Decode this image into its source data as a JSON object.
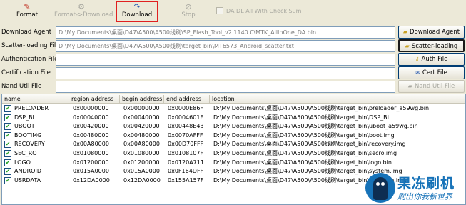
{
  "toolbar": {
    "format": {
      "label": "Format",
      "icon": "format-icon"
    },
    "format_download": {
      "label": "Format->Download",
      "icon": "format-download-icon"
    },
    "download": {
      "label": "Download",
      "icon": "download-icon"
    },
    "stop": {
      "label": "Stop",
      "icon": "stop-icon"
    },
    "checksum_label": "DA DL All With Check Sum"
  },
  "files": [
    {
      "label": "Download Agent",
      "value": "D:\\My Documents\\桌面\\D47\\A500\\A500线刷\\SP_Flash_Tool_v2.1140.0\\MTK_AllInOne_DA.bin",
      "button": "Download Agent",
      "icon": "folder-icon"
    },
    {
      "label": "Scatter-loading File",
      "value": "D:\\My Documents\\桌面\\D47\\A500\\A500线刷\\target_bin\\MT6573_Android_scatter.txt",
      "button": "Scatter-loading",
      "icon": "folder-icon"
    },
    {
      "label": "Authentication File",
      "value": "",
      "button": "Auth File",
      "icon": "key-icon"
    },
    {
      "label": "Certification File",
      "value": "",
      "button": "Cert File",
      "icon": "certificate-icon"
    },
    {
      "label": "Nand Util File",
      "value": "",
      "button": "Nand Util File",
      "icon": "folder-icon"
    }
  ],
  "table": {
    "headers": [
      "name",
      "region address",
      "begin address",
      "end address",
      "location"
    ],
    "rows": [
      {
        "checked": true,
        "name": "PRELOADER",
        "region": "0x00000000",
        "begin": "0x00000000",
        "end": "0x0000E86F",
        "location": "D:\\My Documents\\桌面\\D47\\A500\\A500线刷\\target_bin\\preloader_a59wg.bin"
      },
      {
        "checked": true,
        "name": "DSP_BL",
        "region": "0x00040000",
        "begin": "0x00040000",
        "end": "0x0004601F",
        "location": "D:\\My Documents\\桌面\\D47\\A500\\A500线刷\\target_bin\\DSP_BL"
      },
      {
        "checked": true,
        "name": "UBOOT",
        "region": "0x00420000",
        "begin": "0x00420000",
        "end": "0x00448E43",
        "location": "D:\\My Documents\\桌面\\D47\\A500\\A500线刷\\target_bin\\uboot_a59wg.bin"
      },
      {
        "checked": true,
        "name": "BOOTIMG",
        "region": "0x00480000",
        "begin": "0x00480000",
        "end": "0x0070AFFF",
        "location": "D:\\My Documents\\桌面\\D47\\A500\\A500线刷\\target_bin\\boot.img"
      },
      {
        "checked": true,
        "name": "RECOVERY",
        "region": "0x00A80000",
        "begin": "0x00A80000",
        "end": "0x00D70FFF",
        "location": "D:\\My Documents\\桌面\\D47\\A500\\A500线刷\\target_bin\\recovery.img"
      },
      {
        "checked": true,
        "name": "SEC_RO",
        "region": "0x01080000",
        "begin": "0x01080000",
        "end": "0x0108107F",
        "location": "D:\\My Documents\\桌面\\D47\\A500\\A500线刷\\target_bin\\secro.img"
      },
      {
        "checked": true,
        "name": "LOGO",
        "region": "0x01200000",
        "begin": "0x01200000",
        "end": "0x0120A711",
        "location": "D:\\My Documents\\桌面\\D47\\A500\\A500线刷\\target_bin\\logo.bin"
      },
      {
        "checked": true,
        "name": "ANDROID",
        "region": "0x015A0000",
        "begin": "0x015A0000",
        "end": "0x0F164DFF",
        "location": "D:\\My Documents\\桌面\\D47\\A500\\A500线刷\\target_bin\\system.img"
      },
      {
        "checked": true,
        "name": "USRDATA",
        "region": "0x12DA0000",
        "begin": "0x12DA0000",
        "end": "0x155A157F",
        "location": "D:\\My Documents\\桌面\\D47\\A500\\A500线刷\\target_bin\\userdata.img"
      }
    ]
  },
  "watermark": {
    "title": "果冻刷机",
    "subtitle": "刷出你我新世界"
  },
  "colors": {
    "highlight": "#e02020",
    "watermark": "#1672b8",
    "check": "#21a121"
  }
}
